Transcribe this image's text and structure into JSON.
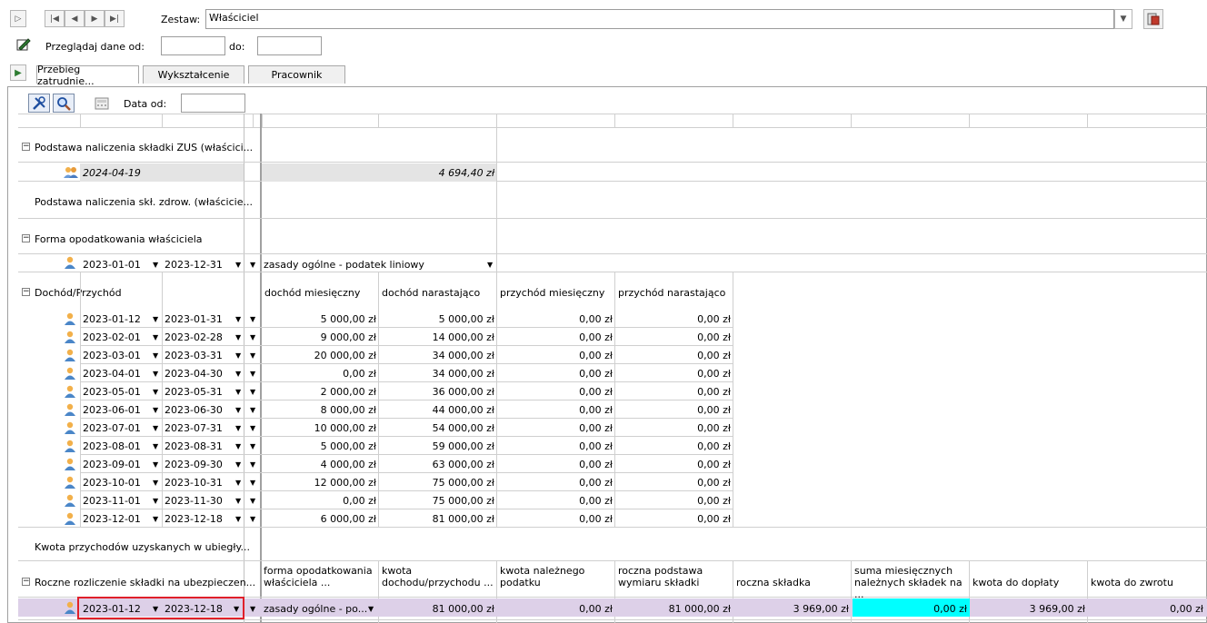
{
  "toolbar": {
    "zestaw_label": "Zestaw:",
    "zestaw_value": "Właściciel",
    "przegladaj_label": "Przeglądaj dane od:",
    "do_label": "do:",
    "od_value": "",
    "do_value": ""
  },
  "tabs": [
    "Przebieg zatrudnie...",
    "Wykształcenie",
    "Pracownik"
  ],
  "inner": {
    "data_od_label": "Data od:",
    "data_od_value": ""
  },
  "groups": {
    "zus": "Podstawa naliczenia składki ZUS (właścici...",
    "zus_row": {
      "date": "2024-04-19",
      "value": "4 694,40 zł"
    },
    "zdrow": "Podstawa naliczenia skł. zdrow. (właścicie...",
    "forma": "Forma opodatkowania właściciela",
    "forma_row": {
      "from": "2023-01-01",
      "to": "2023-12-31",
      "value": "zasady ogólne - podatek liniowy"
    },
    "dochod": "Dochód/Przychód",
    "kwota_przych": "Kwota przychodów uzyskanych w ubiegły...",
    "roczne": "Roczne rozliczenie składki na ubezpieczen..."
  },
  "dochod_headers": [
    "dochód miesięczny",
    "dochód narastająco",
    "przychód miesięczny",
    "przychód narastająco"
  ],
  "dochod_rows": [
    {
      "from": "2023-01-12",
      "to": "2023-01-31",
      "dm": "5 000,00 zł",
      "dn": "5 000,00 zł",
      "pm": "0,00 zł",
      "pn": "0,00 zł"
    },
    {
      "from": "2023-02-01",
      "to": "2023-02-28",
      "dm": "9 000,00 zł",
      "dn": "14 000,00 zł",
      "pm": "0,00 zł",
      "pn": "0,00 zł"
    },
    {
      "from": "2023-03-01",
      "to": "2023-03-31",
      "dm": "20 000,00 zł",
      "dn": "34 000,00 zł",
      "pm": "0,00 zł",
      "pn": "0,00 zł"
    },
    {
      "from": "2023-04-01",
      "to": "2023-04-30",
      "dm": "0,00 zł",
      "dn": "34 000,00 zł",
      "pm": "0,00 zł",
      "pn": "0,00 zł"
    },
    {
      "from": "2023-05-01",
      "to": "2023-05-31",
      "dm": "2 000,00 zł",
      "dn": "36 000,00 zł",
      "pm": "0,00 zł",
      "pn": "0,00 zł"
    },
    {
      "from": "2023-06-01",
      "to": "2023-06-30",
      "dm": "8 000,00 zł",
      "dn": "44 000,00 zł",
      "pm": "0,00 zł",
      "pn": "0,00 zł"
    },
    {
      "from": "2023-07-01",
      "to": "2023-07-31",
      "dm": "10 000,00 zł",
      "dn": "54 000,00 zł",
      "pm": "0,00 zł",
      "pn": "0,00 zł"
    },
    {
      "from": "2023-08-01",
      "to": "2023-08-31",
      "dm": "5 000,00 zł",
      "dn": "59 000,00 zł",
      "pm": "0,00 zł",
      "pn": "0,00 zł"
    },
    {
      "from": "2023-09-01",
      "to": "2023-09-30",
      "dm": "4 000,00 zł",
      "dn": "63 000,00 zł",
      "pm": "0,00 zł",
      "pn": "0,00 zł"
    },
    {
      "from": "2023-10-01",
      "to": "2023-10-31",
      "dm": "12 000,00 zł",
      "dn": "75 000,00 zł",
      "pm": "0,00 zł",
      "pn": "0,00 zł"
    },
    {
      "from": "2023-11-01",
      "to": "2023-11-30",
      "dm": "0,00 zł",
      "dn": "75 000,00 zł",
      "pm": "0,00 zł",
      "pn": "0,00 zł"
    },
    {
      "from": "2023-12-01",
      "to": "2023-12-18",
      "dm": "6 000,00 zł",
      "dn": "81 000,00 zł",
      "pm": "0,00 zł",
      "pn": "0,00 zł"
    }
  ],
  "roczne_headers": [
    "forma opodatkowania właściciela ...",
    "kwota dochodu/przychodu ...",
    "kwota należnego podatku",
    "roczna podstawa wymiaru składki",
    "roczna składka",
    "suma miesięcznych należnych składek na ...",
    "kwota do dopłaty",
    "kwota do zwrotu"
  ],
  "roczne_row": {
    "from": "2023-01-12",
    "to": "2023-12-18",
    "forma": "zasady ogólne - po...",
    "kwota": "81 000,00 zł",
    "podatek": "0,00 zł",
    "podstawa": "81 000,00 zł",
    "skladka": "3 969,00 zł",
    "suma": "0,00 zł",
    "doplata": "3 969,00 zł",
    "zwrot": "0,00 zł"
  },
  "colors": {
    "highlight_row": "#ddd0e8",
    "cyan_cell": "#00ffff",
    "selection_border": "#e0202a",
    "grey_row": "#e4e4e4"
  }
}
